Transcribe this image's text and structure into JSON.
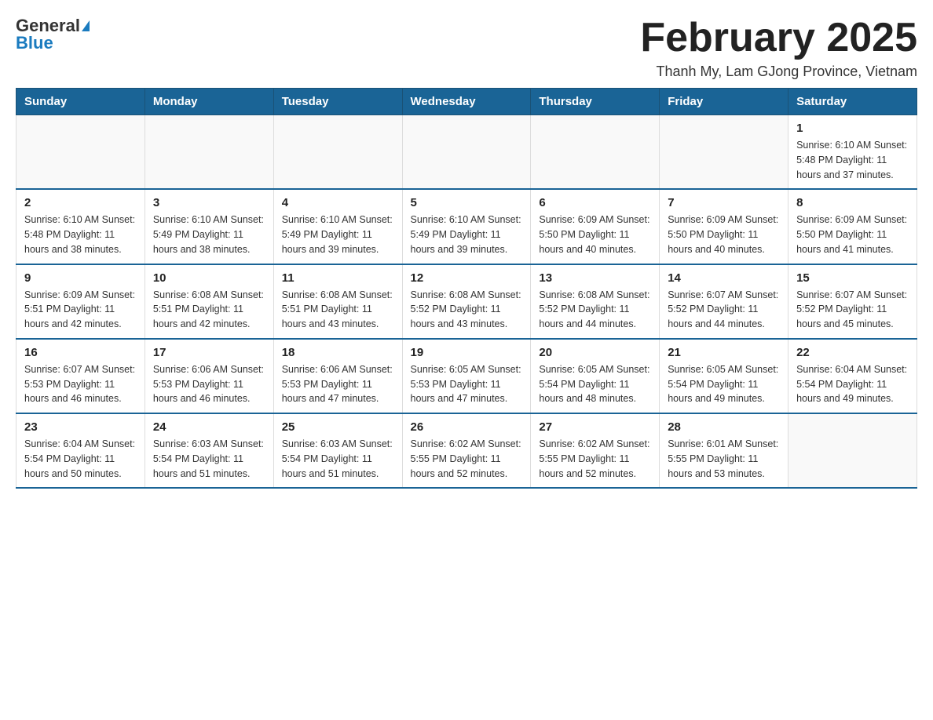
{
  "header": {
    "logo_general": "General",
    "logo_blue": "Blue",
    "month_title": "February 2025",
    "location": "Thanh My, Lam GJong Province, Vietnam"
  },
  "weekdays": [
    "Sunday",
    "Monday",
    "Tuesday",
    "Wednesday",
    "Thursday",
    "Friday",
    "Saturday"
  ],
  "weeks": [
    [
      {
        "day": "",
        "info": ""
      },
      {
        "day": "",
        "info": ""
      },
      {
        "day": "",
        "info": ""
      },
      {
        "day": "",
        "info": ""
      },
      {
        "day": "",
        "info": ""
      },
      {
        "day": "",
        "info": ""
      },
      {
        "day": "1",
        "info": "Sunrise: 6:10 AM\nSunset: 5:48 PM\nDaylight: 11 hours and 37 minutes."
      }
    ],
    [
      {
        "day": "2",
        "info": "Sunrise: 6:10 AM\nSunset: 5:48 PM\nDaylight: 11 hours and 38 minutes."
      },
      {
        "day": "3",
        "info": "Sunrise: 6:10 AM\nSunset: 5:49 PM\nDaylight: 11 hours and 38 minutes."
      },
      {
        "day": "4",
        "info": "Sunrise: 6:10 AM\nSunset: 5:49 PM\nDaylight: 11 hours and 39 minutes."
      },
      {
        "day": "5",
        "info": "Sunrise: 6:10 AM\nSunset: 5:49 PM\nDaylight: 11 hours and 39 minutes."
      },
      {
        "day": "6",
        "info": "Sunrise: 6:09 AM\nSunset: 5:50 PM\nDaylight: 11 hours and 40 minutes."
      },
      {
        "day": "7",
        "info": "Sunrise: 6:09 AM\nSunset: 5:50 PM\nDaylight: 11 hours and 40 minutes."
      },
      {
        "day": "8",
        "info": "Sunrise: 6:09 AM\nSunset: 5:50 PM\nDaylight: 11 hours and 41 minutes."
      }
    ],
    [
      {
        "day": "9",
        "info": "Sunrise: 6:09 AM\nSunset: 5:51 PM\nDaylight: 11 hours and 42 minutes."
      },
      {
        "day": "10",
        "info": "Sunrise: 6:08 AM\nSunset: 5:51 PM\nDaylight: 11 hours and 42 minutes."
      },
      {
        "day": "11",
        "info": "Sunrise: 6:08 AM\nSunset: 5:51 PM\nDaylight: 11 hours and 43 minutes."
      },
      {
        "day": "12",
        "info": "Sunrise: 6:08 AM\nSunset: 5:52 PM\nDaylight: 11 hours and 43 minutes."
      },
      {
        "day": "13",
        "info": "Sunrise: 6:08 AM\nSunset: 5:52 PM\nDaylight: 11 hours and 44 minutes."
      },
      {
        "day": "14",
        "info": "Sunrise: 6:07 AM\nSunset: 5:52 PM\nDaylight: 11 hours and 44 minutes."
      },
      {
        "day": "15",
        "info": "Sunrise: 6:07 AM\nSunset: 5:52 PM\nDaylight: 11 hours and 45 minutes."
      }
    ],
    [
      {
        "day": "16",
        "info": "Sunrise: 6:07 AM\nSunset: 5:53 PM\nDaylight: 11 hours and 46 minutes."
      },
      {
        "day": "17",
        "info": "Sunrise: 6:06 AM\nSunset: 5:53 PM\nDaylight: 11 hours and 46 minutes."
      },
      {
        "day": "18",
        "info": "Sunrise: 6:06 AM\nSunset: 5:53 PM\nDaylight: 11 hours and 47 minutes."
      },
      {
        "day": "19",
        "info": "Sunrise: 6:05 AM\nSunset: 5:53 PM\nDaylight: 11 hours and 47 minutes."
      },
      {
        "day": "20",
        "info": "Sunrise: 6:05 AM\nSunset: 5:54 PM\nDaylight: 11 hours and 48 minutes."
      },
      {
        "day": "21",
        "info": "Sunrise: 6:05 AM\nSunset: 5:54 PM\nDaylight: 11 hours and 49 minutes."
      },
      {
        "day": "22",
        "info": "Sunrise: 6:04 AM\nSunset: 5:54 PM\nDaylight: 11 hours and 49 minutes."
      }
    ],
    [
      {
        "day": "23",
        "info": "Sunrise: 6:04 AM\nSunset: 5:54 PM\nDaylight: 11 hours and 50 minutes."
      },
      {
        "day": "24",
        "info": "Sunrise: 6:03 AM\nSunset: 5:54 PM\nDaylight: 11 hours and 51 minutes."
      },
      {
        "day": "25",
        "info": "Sunrise: 6:03 AM\nSunset: 5:54 PM\nDaylight: 11 hours and 51 minutes."
      },
      {
        "day": "26",
        "info": "Sunrise: 6:02 AM\nSunset: 5:55 PM\nDaylight: 11 hours and 52 minutes."
      },
      {
        "day": "27",
        "info": "Sunrise: 6:02 AM\nSunset: 5:55 PM\nDaylight: 11 hours and 52 minutes."
      },
      {
        "day": "28",
        "info": "Sunrise: 6:01 AM\nSunset: 5:55 PM\nDaylight: 11 hours and 53 minutes."
      },
      {
        "day": "",
        "info": ""
      }
    ]
  ]
}
